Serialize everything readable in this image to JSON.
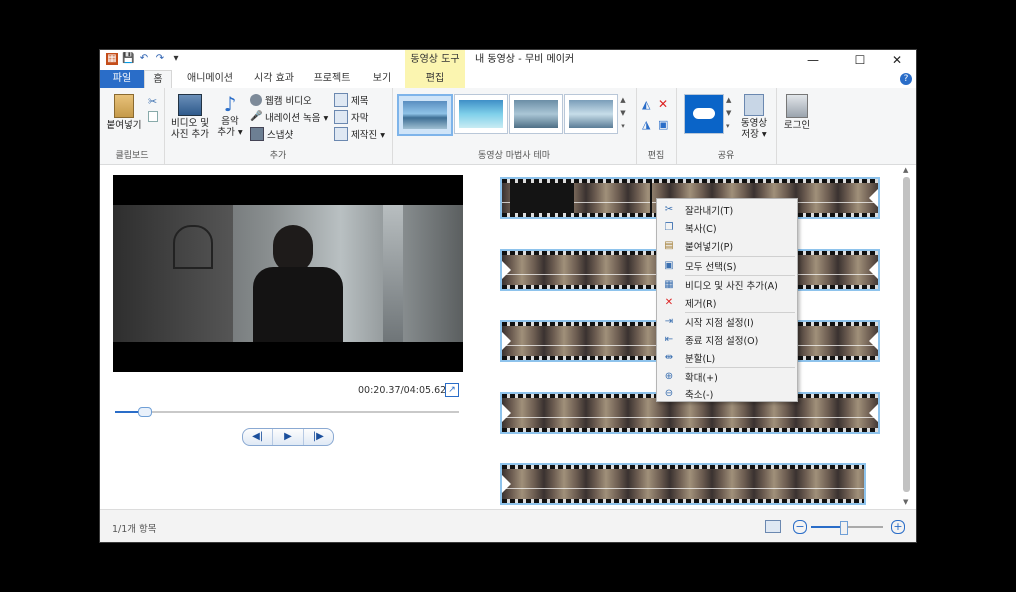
{
  "titlebar": {
    "title": "내 동영상 - 무비 메이커",
    "context_tab": "동영상 도구",
    "minimize": "—",
    "maximize": "☐",
    "close": "✕"
  },
  "tabs": [
    {
      "label": "파일"
    },
    {
      "label": "홈"
    },
    {
      "label": "애니메이션"
    },
    {
      "label": "시각 효과"
    },
    {
      "label": "프로젝트"
    },
    {
      "label": "보기"
    },
    {
      "label": "편집"
    }
  ],
  "ribbon": {
    "clipboard": {
      "paste": "붙여넣기",
      "group_label": "클립보드"
    },
    "add": {
      "add_video": "비디오 및",
      "add_video2": "사진 추가",
      "music": "음악",
      "music2": "추가 ▾",
      "webcam": "웹캠 비디오",
      "narration": "내레이션 녹음 ▾",
      "snapshot": "스냅샷",
      "title": "제목",
      "caption": "자막",
      "credits": "제작진 ▾",
      "group_label": "추가"
    },
    "themes": {
      "group_label": "동영상 마법사 테마"
    },
    "edit": {
      "group_label": "편집"
    },
    "share": {
      "save": "동영상",
      "save2": "저장 ▾",
      "group_label": "공유"
    },
    "login": "로그인"
  },
  "preview": {
    "time": "00:20.37/04:05.62",
    "progress": 0.083
  },
  "context_menu": [
    {
      "label": "잘라내기(T)",
      "icon": "scissors-icon"
    },
    {
      "label": "복사(C)",
      "icon": "copy-icon"
    },
    {
      "label": "붙여넣기(P)",
      "icon": "paste-icon"
    },
    {
      "label": "모두 선택(S)",
      "icon": "select-all-icon"
    },
    {
      "label": "비디오 및 사진 추가(A)",
      "icon": "add-video-icon"
    },
    {
      "label": "제거(R)",
      "icon": "remove-icon"
    },
    {
      "label": "시작 지점 설정(I)",
      "icon": "set-start-icon"
    },
    {
      "label": "종료 지점 설정(O)",
      "icon": "set-end-icon"
    },
    {
      "label": "분할(L)",
      "icon": "split-icon"
    },
    {
      "label": "확대(+)",
      "icon": "zoom-in-icon"
    },
    {
      "label": "축소(-)",
      "icon": "zoom-out-icon"
    }
  ],
  "status": {
    "items": "1/1개 항목",
    "zoom_level": 0.45
  },
  "colors": {
    "accent": "#2a6dc8",
    "context_tab": "#fbf5b0",
    "strip_border": "#8ec3ec"
  }
}
